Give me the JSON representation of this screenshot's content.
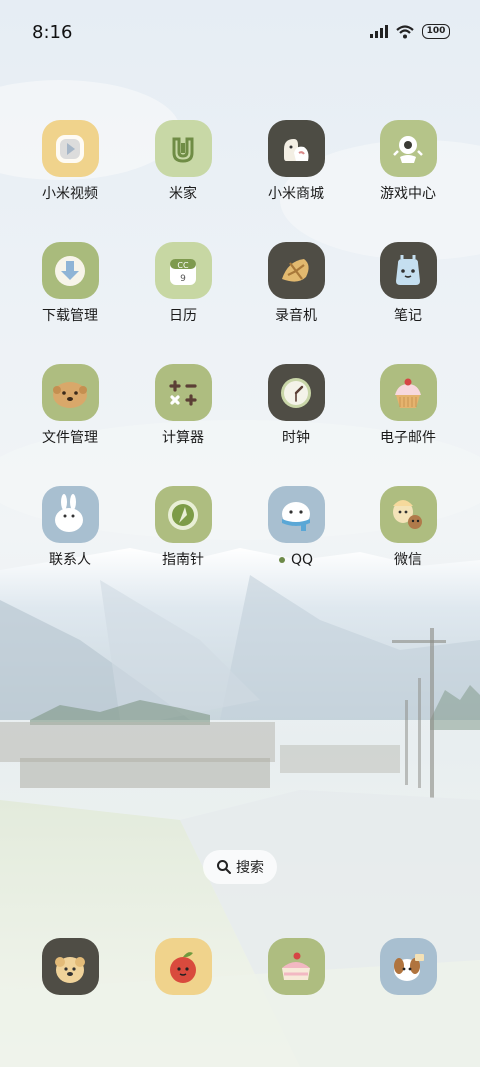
{
  "status": {
    "time": "8:16",
    "battery": "100"
  },
  "apps": [
    {
      "label": "小米视频",
      "icon": "mi-video-icon",
      "color": "#f0d38c"
    },
    {
      "label": "米家",
      "icon": "mijia-icon",
      "color": "#c8d8a6"
    },
    {
      "label": "小米商城",
      "icon": "mi-store-icon",
      "color": "#4d4c44"
    },
    {
      "label": "游戏中心",
      "icon": "game-center-icon",
      "color": "#b5c489"
    },
    {
      "label": "下载管理",
      "icon": "download-manager-icon",
      "color": "#a9bb7c"
    },
    {
      "label": "日历",
      "icon": "calendar-icon",
      "color": "#c7d7a3"
    },
    {
      "label": "录音机",
      "icon": "recorder-icon",
      "color": "#4f4d45"
    },
    {
      "label": "笔记",
      "icon": "notes-icon",
      "color": "#4f4d45"
    },
    {
      "label": "文件管理",
      "icon": "file-manager-icon",
      "color": "#aebd80"
    },
    {
      "label": "计算器",
      "icon": "calculator-icon",
      "color": "#aebd80"
    },
    {
      "label": "时钟",
      "icon": "clock-icon",
      "color": "#4f4d45"
    },
    {
      "label": "电子邮件",
      "icon": "email-icon",
      "color": "#aebd80"
    },
    {
      "label": "联系人",
      "icon": "contacts-icon",
      "color": "#a8bfd0"
    },
    {
      "label": "指南针",
      "icon": "compass-icon",
      "color": "#aebd80"
    },
    {
      "label": "QQ",
      "icon": "qq-icon",
      "color": "#a8bfd0",
      "notification_dot": true
    },
    {
      "label": "微信",
      "icon": "wechat-icon",
      "color": "#aebd80"
    }
  ],
  "search": {
    "label": "搜索"
  },
  "dock": [
    {
      "icon": "phone-icon",
      "color": "#4f4d45"
    },
    {
      "icon": "messages-icon",
      "color": "#f0d38c"
    },
    {
      "icon": "browser-icon",
      "color": "#aebd80"
    },
    {
      "icon": "camera-icon",
      "color": "#a8bfd0"
    }
  ]
}
